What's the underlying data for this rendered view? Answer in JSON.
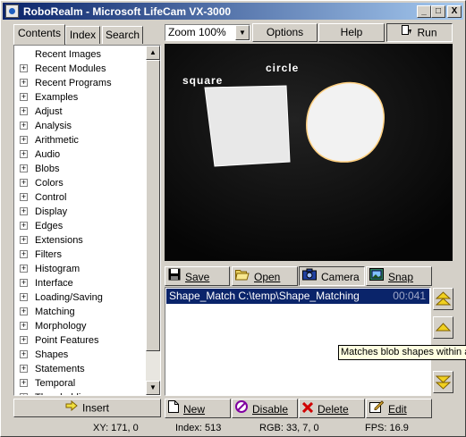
{
  "window": {
    "title": "RoboRealm - Microsoft LifeCam VX-3000",
    "minimize": "_",
    "maximize": "□",
    "close": "X"
  },
  "left_tabs": [
    "Contents",
    "Index",
    "Search"
  ],
  "tree": {
    "items": [
      {
        "label": "Recent Images",
        "expander": false
      },
      {
        "label": "Recent Modules",
        "expander": true
      },
      {
        "label": "Recent Programs",
        "expander": true
      },
      {
        "label": "Examples",
        "expander": true
      },
      {
        "label": "Adjust",
        "expander": true
      },
      {
        "label": "Analysis",
        "expander": true
      },
      {
        "label": "Arithmetic",
        "expander": true
      },
      {
        "label": "Audio",
        "expander": true
      },
      {
        "label": "Blobs",
        "expander": true
      },
      {
        "label": "Colors",
        "expander": true
      },
      {
        "label": "Control",
        "expander": true
      },
      {
        "label": "Display",
        "expander": true
      },
      {
        "label": "Edges",
        "expander": true
      },
      {
        "label": "Extensions",
        "expander": true
      },
      {
        "label": "Filters",
        "expander": true
      },
      {
        "label": "Histogram",
        "expander": true
      },
      {
        "label": "Interface",
        "expander": true
      },
      {
        "label": "Loading/Saving",
        "expander": true
      },
      {
        "label": "Matching",
        "expander": true
      },
      {
        "label": "Morphology",
        "expander": true
      },
      {
        "label": "Point Features",
        "expander": true
      },
      {
        "label": "Shapes",
        "expander": true
      },
      {
        "label": "Statements",
        "expander": true
      },
      {
        "label": "Temporal",
        "expander": true
      },
      {
        "label": "Thresholding",
        "expander": true
      }
    ],
    "expander_symbol": "+"
  },
  "insert_button": "Insert",
  "toolbar": {
    "zoom_value": "Zoom 100%",
    "options": "Options",
    "help": "Help",
    "run": "Run"
  },
  "video": {
    "label_square": "square",
    "label_circle": "circle"
  },
  "pipeline_toolbar": {
    "save": "Save",
    "open": "Open",
    "camera": "Camera",
    "snap": "Snap"
  },
  "pipeline": {
    "items": [
      {
        "name": "Shape_Match C:\\temp\\Shape_Matching",
        "time": "00:041"
      }
    ]
  },
  "tooltip": "Matches blob shapes within an image",
  "bottom_toolbar": {
    "new": "New",
    "disable": "Disable",
    "delete": "Delete",
    "edit": "Edit"
  },
  "status": {
    "xy": "XY: 171, 0",
    "index": "Index: 513",
    "rgb": "RGB: 33, 7, 0",
    "fps": "FPS: 16.9"
  },
  "colors": {
    "title_bar": "#0a246a",
    "selection": "#0a246a",
    "tooltip_bg": "#ffffe1"
  }
}
